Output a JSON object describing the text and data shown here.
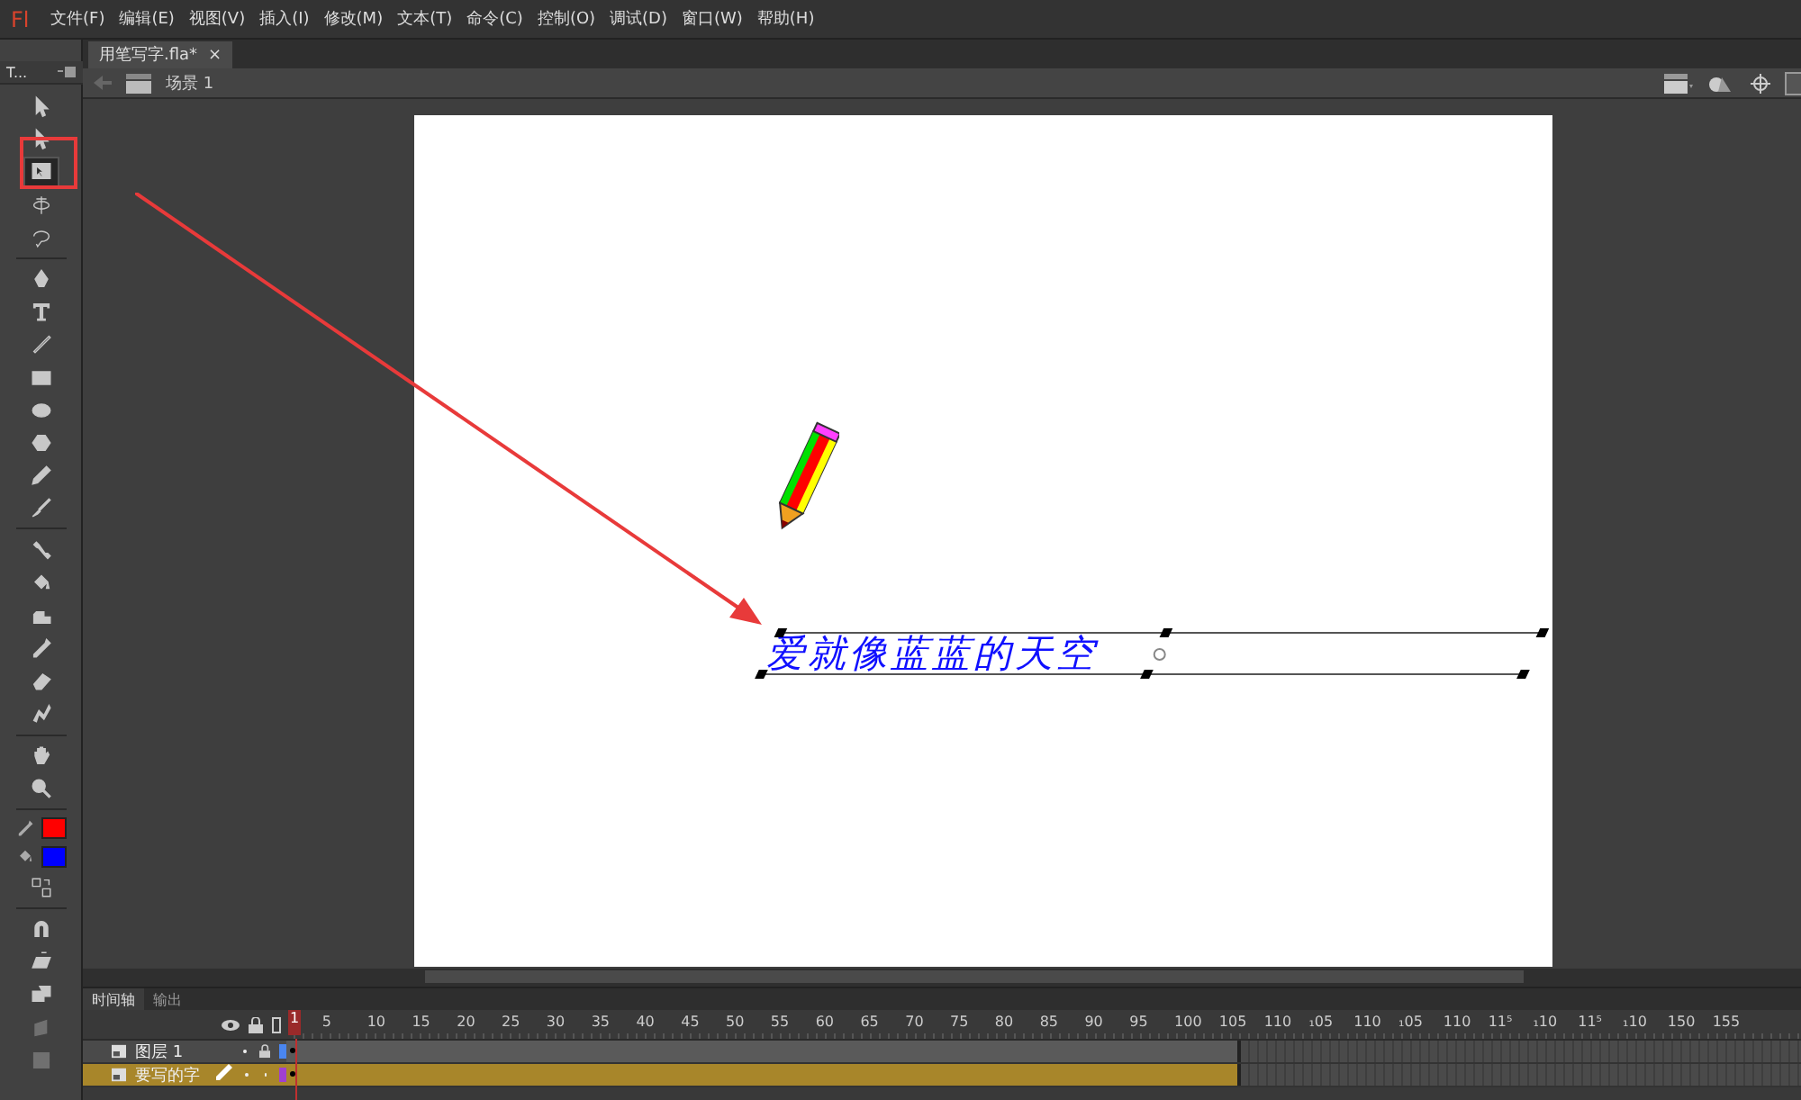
{
  "app_logo": "Fl",
  "menu": [
    "文件(F)",
    "编辑(E)",
    "视图(V)",
    "插入(I)",
    "修改(M)",
    "文本(T)",
    "命令(C)",
    "控制(O)",
    "调试(D)",
    "窗口(W)",
    "帮助(H)"
  ],
  "tools_panel": {
    "tab": "T..."
  },
  "tool_groups": [
    [
      {
        "kind": "arrow",
        "selected": false,
        "disabled": false
      },
      {
        "kind": "subselect",
        "selected": false,
        "disabled": false
      },
      {
        "kind": "transform",
        "selected": true,
        "disabled": false
      },
      {
        "kind": "rotate3d",
        "selected": false,
        "disabled": false
      },
      {
        "kind": "lasso",
        "selected": false,
        "disabled": false
      }
    ],
    [
      {
        "kind": "pen",
        "selected": false,
        "disabled": false
      },
      {
        "kind": "text",
        "selected": false,
        "disabled": false
      },
      {
        "kind": "line",
        "selected": false,
        "disabled": false
      },
      {
        "kind": "rect",
        "selected": false,
        "disabled": false
      },
      {
        "kind": "oval",
        "selected": false,
        "disabled": false
      },
      {
        "kind": "polygon",
        "selected": false,
        "disabled": false
      },
      {
        "kind": "pencil",
        "selected": false,
        "disabled": false
      },
      {
        "kind": "brush",
        "selected": false,
        "disabled": false
      }
    ],
    [
      {
        "kind": "bone",
        "selected": false,
        "disabled": false
      },
      {
        "kind": "bucket",
        "selected": false,
        "disabled": false
      },
      {
        "kind": "inkbottle",
        "selected": false,
        "disabled": false
      },
      {
        "kind": "eyedropper",
        "selected": false,
        "disabled": false
      },
      {
        "kind": "eraser",
        "selected": false,
        "disabled": false
      },
      {
        "kind": "deco",
        "selected": false,
        "disabled": false
      }
    ],
    [
      {
        "kind": "hand",
        "selected": false,
        "disabled": false
      },
      {
        "kind": "zoom",
        "selected": false,
        "disabled": false
      }
    ]
  ],
  "color_swatches": [
    {
      "kind": "stroke",
      "color": "#ff0000"
    },
    {
      "kind": "fill",
      "color": "#0000ff"
    }
  ],
  "option_tools": [
    {
      "kind": "snap",
      "selected": false,
      "disabled": false
    },
    {
      "kind": "smooth",
      "selected": false,
      "disabled": false
    },
    {
      "kind": "straighten",
      "selected": false,
      "disabled": false
    },
    {
      "kind": "rotate",
      "selected": false,
      "disabled": true
    },
    {
      "kind": "scale",
      "selected": false,
      "disabled": true
    }
  ],
  "document_tab": {
    "title": "用笔写字.fla*",
    "close": "×"
  },
  "scene": {
    "label": "场景 1"
  },
  "stage": {
    "text": "爱就像蓝蓝的天空"
  },
  "timeline": {
    "tabs": [
      {
        "label": "时间轴",
        "selected": true
      },
      {
        "label": "输出",
        "selected": false
      }
    ],
    "frame_labels": [
      "1",
      "5",
      "10",
      "15",
      "20",
      "25",
      "30",
      "35",
      "40",
      "45",
      "50",
      "55",
      "60",
      "65",
      "70",
      "75",
      "80",
      "85",
      "90",
      "95",
      "100",
      "105",
      "110",
      "₁05",
      "110",
      "₁05",
      "110",
      "11⁵",
      "₁10",
      "11⁵",
      "₁10",
      "150",
      "155"
    ],
    "layers": [
      {
        "name": "图层 1",
        "selected": false,
        "editing": false,
        "locked": true,
        "color": "#4a86f0"
      },
      {
        "name": "要写的字",
        "selected": true,
        "editing": true,
        "locked": false,
        "color": "#a040d0"
      }
    ]
  }
}
